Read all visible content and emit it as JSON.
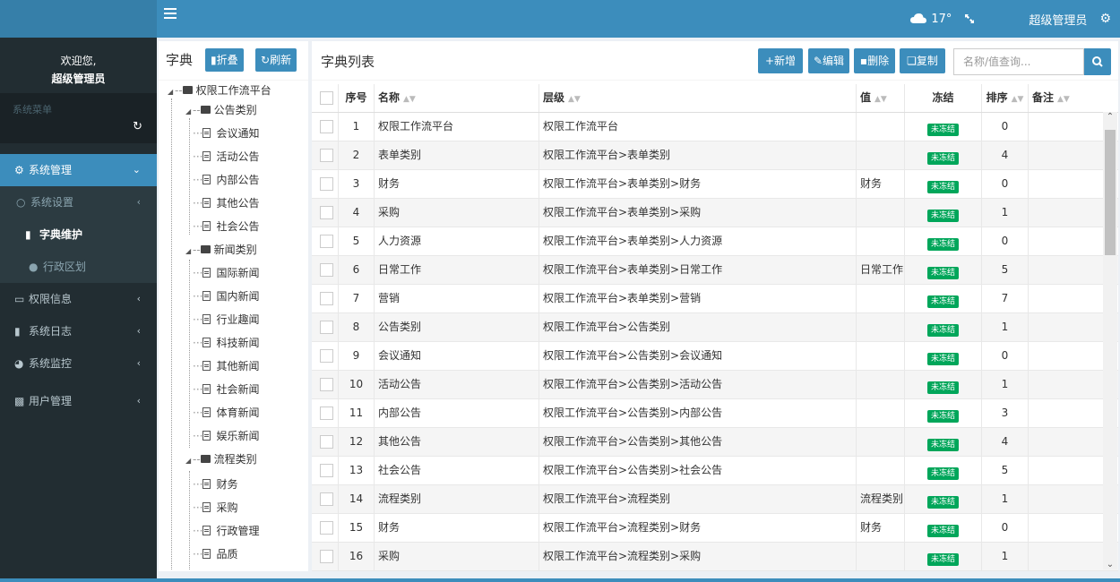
{
  "colors": {
    "topbar": "#3c8dbc",
    "sidebar": "#222d32",
    "active": "#3c8dbc",
    "badge": "#00a65a"
  },
  "topbar": {
    "weather": "17°",
    "user": "超级管理员"
  },
  "sidebar": {
    "welcome": "欢迎您,",
    "user": "超级管理员",
    "menu_label": "系统菜单",
    "items": [
      {
        "label": "系统管理",
        "icon": "gear-icon"
      },
      {
        "label": "系统设置",
        "icon": "settings-icon"
      },
      {
        "label": "字典维护",
        "icon": "book-icon"
      },
      {
        "label": "行政区划",
        "icon": "location-icon"
      },
      {
        "label": "权限信息",
        "icon": "monitor-icon"
      },
      {
        "label": "系统日志",
        "icon": "copy-icon"
      },
      {
        "label": "系统监控",
        "icon": "dashboard-icon"
      },
      {
        "label": "用户管理",
        "icon": "id-card-icon"
      }
    ]
  },
  "tree": {
    "title": "字典",
    "collapse": "折叠",
    "refresh": "刷新",
    "root": "权限工作流平台",
    "g1": "公告类别",
    "g1_items": [
      "会议通知",
      "活动公告",
      "内部公告",
      "其他公告",
      "社会公告"
    ],
    "g2": "新闻类别",
    "g2_items": [
      "国际新闻",
      "国内新闻",
      "行业趣闻",
      "科技新闻",
      "其他新闻",
      "社会新闻",
      "体育新闻",
      "娱乐新闻"
    ],
    "g3": "流程类别",
    "g3_items": [
      "财务",
      "采购",
      "行政管理",
      "品质"
    ]
  },
  "main": {
    "title": "字典列表",
    "btn_add": "新增",
    "btn_edit": "编辑",
    "btn_delete": "删除",
    "btn_copy": "复制",
    "search_placeholder": "名称/值查询...",
    "headers": {
      "no": "序号",
      "name": "名称",
      "path": "层级",
      "value": "值",
      "frozen": "冻结",
      "order": "排序",
      "remark": "备注"
    }
  },
  "rows": [
    {
      "no": "1",
      "name": "权限工作流平台",
      "path": "权限工作流平台",
      "value": "",
      "frozen": "未冻结",
      "order": "0"
    },
    {
      "no": "2",
      "name": "表单类别",
      "path": "权限工作流平台>表单类别",
      "value": "",
      "frozen": "未冻结",
      "order": "4"
    },
    {
      "no": "3",
      "name": "财务",
      "path": "权限工作流平台>表单类别>财务",
      "value": "财务",
      "frozen": "未冻结",
      "order": "0"
    },
    {
      "no": "4",
      "name": "采购",
      "path": "权限工作流平台>表单类别>采购",
      "value": "",
      "frozen": "未冻结",
      "order": "1"
    },
    {
      "no": "5",
      "name": "人力资源",
      "path": "权限工作流平台>表单类别>人力资源",
      "value": "",
      "frozen": "未冻结",
      "order": "0"
    },
    {
      "no": "6",
      "name": "日常工作",
      "path": "权限工作流平台>表单类别>日常工作",
      "value": "日常工作",
      "frozen": "未冻结",
      "order": "5"
    },
    {
      "no": "7",
      "name": "营销",
      "path": "权限工作流平台>表单类别>营销",
      "value": "",
      "frozen": "未冻结",
      "order": "7"
    },
    {
      "no": "8",
      "name": "公告类别",
      "path": "权限工作流平台>公告类别",
      "value": "",
      "frozen": "未冻结",
      "order": "1"
    },
    {
      "no": "9",
      "name": "会议通知",
      "path": "权限工作流平台>公告类别>会议通知",
      "value": "",
      "frozen": "未冻结",
      "order": "0"
    },
    {
      "no": "10",
      "name": "活动公告",
      "path": "权限工作流平台>公告类别>活动公告",
      "value": "",
      "frozen": "未冻结",
      "order": "1"
    },
    {
      "no": "11",
      "name": "内部公告",
      "path": "权限工作流平台>公告类别>内部公告",
      "value": "",
      "frozen": "未冻结",
      "order": "3"
    },
    {
      "no": "12",
      "name": "其他公告",
      "path": "权限工作流平台>公告类别>其他公告",
      "value": "",
      "frozen": "未冻结",
      "order": "4"
    },
    {
      "no": "13",
      "name": "社会公告",
      "path": "权限工作流平台>公告类别>社会公告",
      "value": "",
      "frozen": "未冻结",
      "order": "5"
    },
    {
      "no": "14",
      "name": "流程类别",
      "path": "权限工作流平台>流程类别",
      "value": "流程类别",
      "frozen": "未冻结",
      "order": "1"
    },
    {
      "no": "15",
      "name": "财务",
      "path": "权限工作流平台>流程类别>财务",
      "value": "财务",
      "frozen": "未冻结",
      "order": "0"
    },
    {
      "no": "16",
      "name": "采购",
      "path": "权限工作流平台>流程类别>采购",
      "value": "",
      "frozen": "未冻结",
      "order": "1"
    }
  ]
}
